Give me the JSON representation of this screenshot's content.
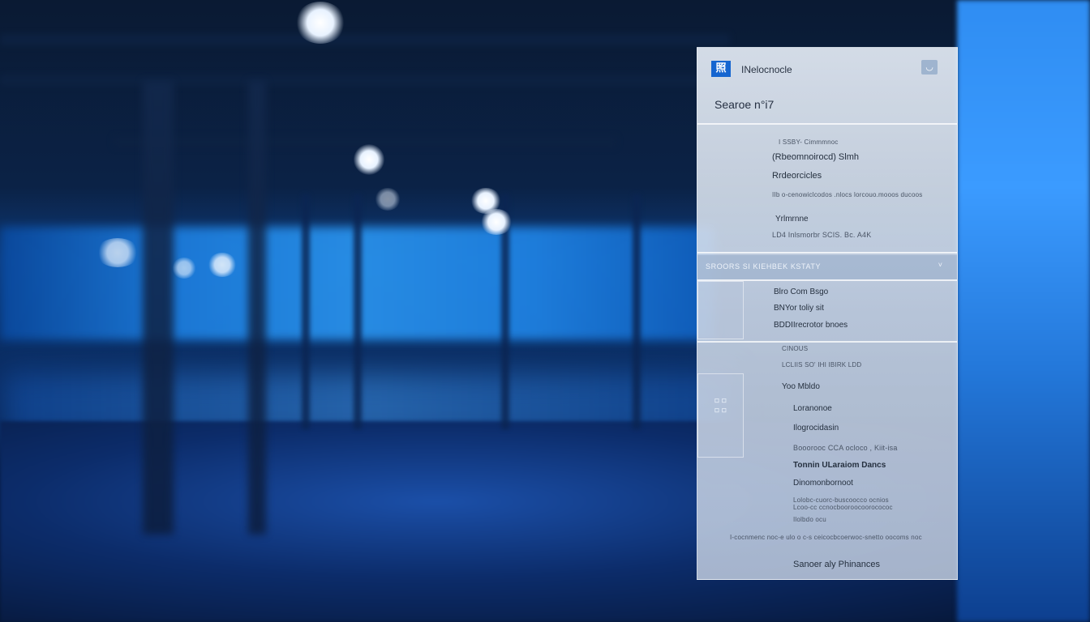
{
  "app": {
    "logo_glyph": "照",
    "title": "INelocnocle",
    "header_button_glyph": "◡"
  },
  "search": {
    "label": "Searoe n°i7"
  },
  "results": {
    "meta_line": "I  SSBY- Cimmmnoc",
    "title": "(Rbeomnoirocd) Slmh",
    "subtitle": "Rrdeorcicles",
    "desc_line": "IIb  o-cenowiclcodos .nlocs  lorcouo.mooos  ducoos",
    "tag": "Yrlmrnne",
    "code_line": "LD4  Inlsmorbr  SCIS. Bc. A4K"
  },
  "section": {
    "label": "SROORS  SI KIEHBEK KSTATY",
    "chevron": "˅"
  },
  "group_one": {
    "items": [
      "Blro Com Bsgo",
      "BNYor toliy sit",
      "BDDIIrecrotor bnoes"
    ]
  },
  "group_two": {
    "meta_a": "CINOUS",
    "meta_b": "LCLIIS  SO'  IHI  IBIRK  LDD",
    "heading": "Yoo  Mbldo",
    "items": [
      "Loranonoe",
      "Ilogrocidasin",
      "Booorooc CCA ocloco , Kiit-isa"
    ],
    "highlight": "Tonnin  ULaraiom  Dancs",
    "item_b": "Dinomonbornoot",
    "desc_a": "Lolobc-cuorc-buscoocco  ocnios",
    "desc_b": "Lcoo-cc ccnocbooroocoorocococ",
    "small": "Ilolbdo  ocu"
  },
  "footer": {
    "line": "I-cocnmenc noc-e ulo o c-s ceicocbcoerwoc-snetto oocoms noc",
    "button_label": "Sanoer aly Phinances"
  },
  "colors": {
    "accent": "#1565d0",
    "panel": "#dfe7f2",
    "background": "#06142e"
  },
  "icons": [
    "app-logo-icon",
    "header-action-icon",
    "chevron-down-icon",
    "grid-icon"
  ]
}
